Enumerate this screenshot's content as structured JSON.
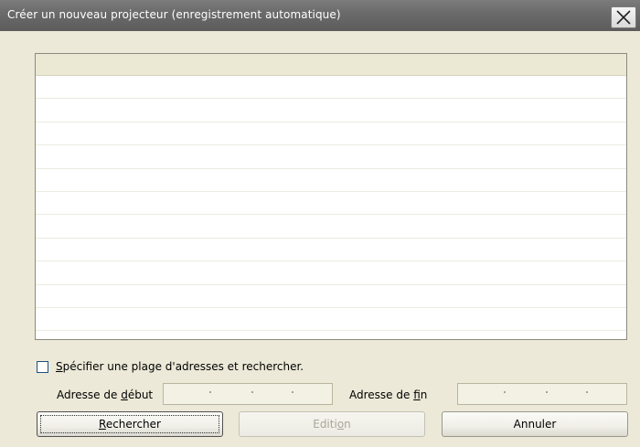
{
  "window": {
    "title": "Créer un nouveau projecteur (enregistrement automatique)",
    "close_label": "X"
  },
  "list": {
    "rows": [
      "",
      "",
      "",
      "",
      "",
      "",
      "",
      "",
      "",
      "",
      "",
      ""
    ]
  },
  "range": {
    "checkbox_label": "Spécifier une plage d'adresses et rechercher.",
    "checked": false,
    "start_label_prefix": "Adresse de ",
    "start_label_key": "d",
    "start_label_suffix": "ébut",
    "end_label_prefix": "Adresse de ",
    "end_label_key": "f",
    "end_label_suffix": "in",
    "start_value": "",
    "end_value": ""
  },
  "buttons": {
    "search_key": "R",
    "search_rest": "echercher",
    "edit_prefix": "Editi",
    "edit_key": "o",
    "edit_suffix": "n",
    "cancel": "Annuler"
  },
  "colors": {
    "titlebar": "#6b6b6b",
    "dialog_bg": "#ece9d8",
    "list_header": "#ebe8d4"
  }
}
